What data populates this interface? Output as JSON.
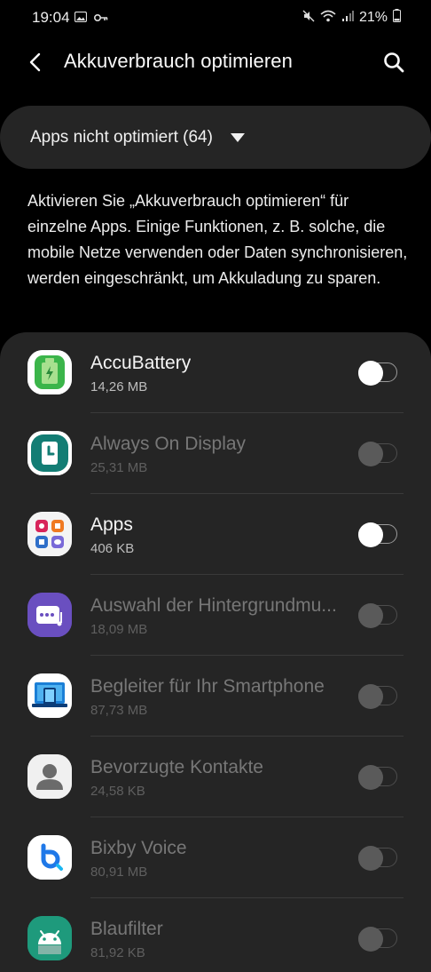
{
  "status_bar": {
    "time": "19:04",
    "battery": "21%"
  },
  "header": {
    "title": "Akkuverbrauch optimieren"
  },
  "filter": {
    "label": "Apps nicht optimiert (64)"
  },
  "description": "Aktivieren Sie „Akkuverbrauch optimieren“ für einzelne Apps. Einige Funktionen, z. B. solche, die mobile Netze verwenden oder Daten synchronisieren, werden eingeschränkt, um Akkuladung zu sparen.",
  "apps": [
    {
      "name": "AccuBattery",
      "size": "14,26 MB",
      "enabled": true,
      "optimized": false,
      "icon": "accubattery-icon"
    },
    {
      "name": "Always On Display",
      "size": "25,31 MB",
      "enabled": false,
      "optimized": false,
      "icon": "always-on-display-icon"
    },
    {
      "name": "Apps",
      "size": "406 KB",
      "enabled": true,
      "optimized": false,
      "icon": "apps-folder-icon"
    },
    {
      "name": "Auswahl der Hintergrundmu...",
      "size": "18,09 MB",
      "enabled": false,
      "optimized": false,
      "icon": "background-music-icon"
    },
    {
      "name": "Begleiter für Ihr Smartphone",
      "size": "87,73 MB",
      "enabled": false,
      "optimized": false,
      "icon": "phone-companion-icon"
    },
    {
      "name": "Bevorzugte Kontakte",
      "size": "24,58 KB",
      "enabled": false,
      "optimized": false,
      "icon": "contact-person-icon"
    },
    {
      "name": "Bixby Voice",
      "size": "80,91 MB",
      "enabled": false,
      "optimized": false,
      "icon": "bixby-icon"
    },
    {
      "name": "Blaufilter",
      "size": "81,92 KB",
      "enabled": false,
      "optimized": false,
      "icon": "android-icon"
    }
  ],
  "colors": {
    "background": "#000000",
    "surface": "#252525",
    "accubattery_green": "#3bb54a",
    "aod_teal": "#137d74",
    "music_purple": "#6a4fc0",
    "companion_blue": "#1b7fd6",
    "android_green": "#1e9a7c"
  }
}
